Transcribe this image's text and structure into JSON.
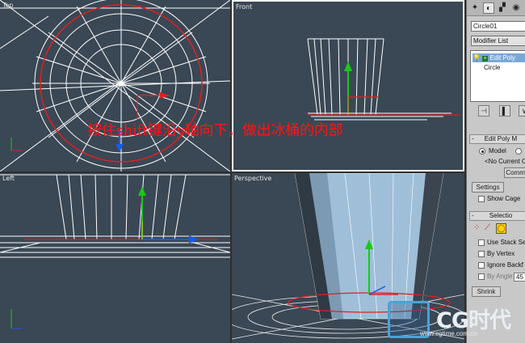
{
  "viewports": {
    "top": "Top",
    "front": "Front",
    "left": "Left",
    "perspective": "Perspective"
  },
  "caption": "按住shift键沿y轴向下，做出冰桶的内部",
  "panel": {
    "object_name": "Circle01",
    "modifier_list": "Modifier List",
    "stack": [
      {
        "label": "Edit Poly",
        "selected": true
      },
      {
        "label": "Circle",
        "selected": false
      }
    ],
    "edit_poly_rollout": "Edit Poly M",
    "mode_model": "Model",
    "no_current": "<No Current O",
    "commit": "Commi",
    "settings": "Settings",
    "show_cage": "Show Cage",
    "selection_rollout": "Selectio",
    "use_stack_sel": "Use Stack Sel",
    "by_vertex": "By Vertex",
    "ignore_backfacing": "Ignore Backf",
    "by_angle": "By Angle",
    "by_angle_value": "45",
    "shrink": "Shrink"
  },
  "watermark": {
    "brand": "CG时代",
    "url": "www.cgtime.com.cn"
  },
  "colors": {
    "viewport_bg": "#3a4754",
    "wire": "#ffffff",
    "selected_wire": "#e02020",
    "gizmo_green": "#19c819",
    "gizmo_blue": "#1a5ae6",
    "caption": "#ff1414",
    "panel_bg": "#c8c8c8"
  }
}
